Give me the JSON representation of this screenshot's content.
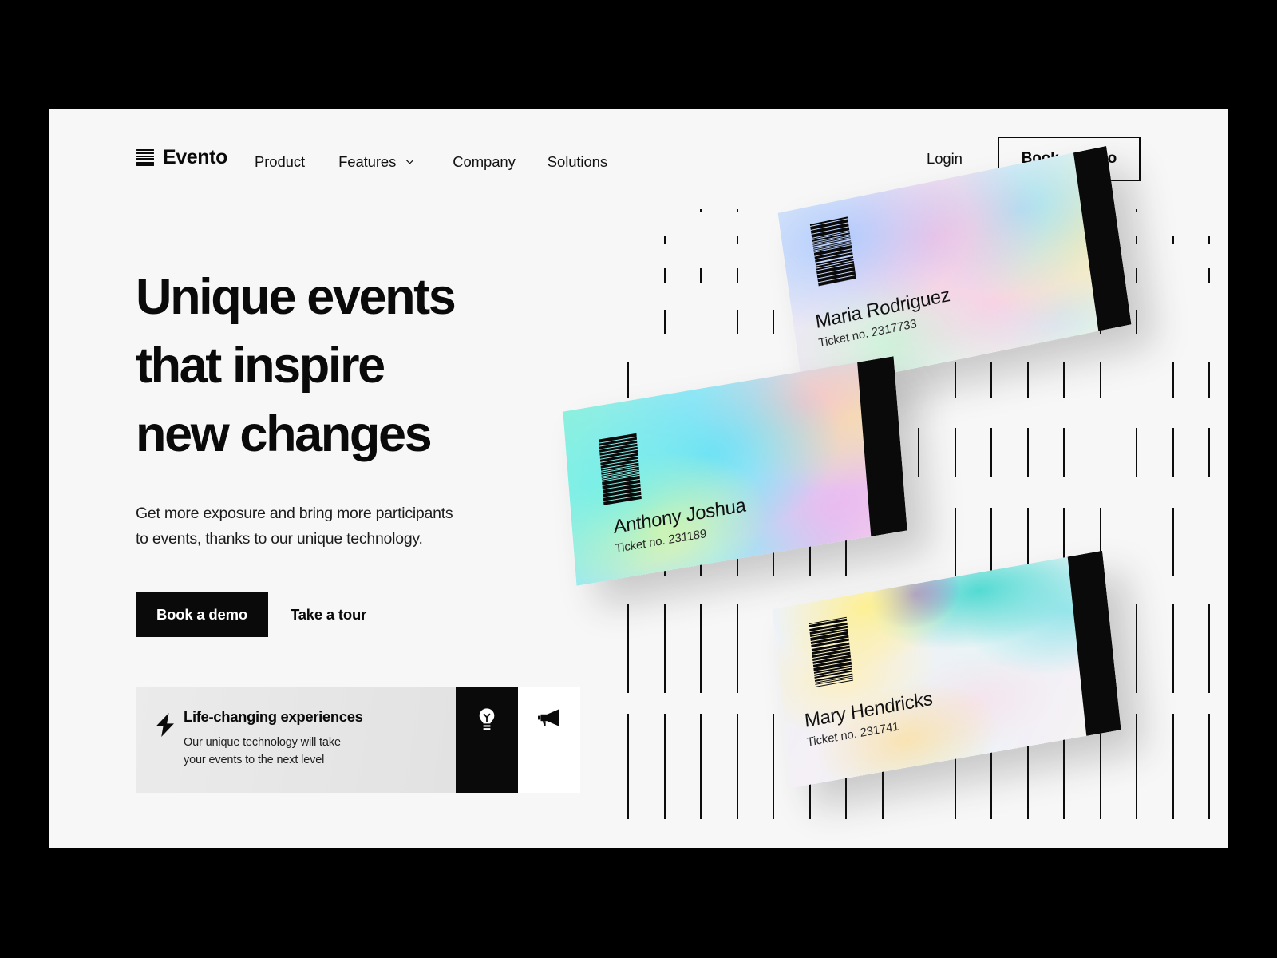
{
  "brand": {
    "name": "Evento",
    "logo_icon": "stacked-bars-icon"
  },
  "nav": {
    "items": [
      {
        "label": "Product",
        "has_dropdown": false
      },
      {
        "label": "Features",
        "has_dropdown": true,
        "icon": "chevron-down-icon"
      },
      {
        "label": "Company",
        "has_dropdown": false
      },
      {
        "label": "Solutions",
        "has_dropdown": false
      }
    ],
    "login_label": "Login",
    "book_demo_label": "Book a Demo"
  },
  "hero": {
    "headline": "Unique events\nthat inspire\nnew changes",
    "subcopy": "Get more exposure and bring more participants\nto events, thanks to our unique technology.",
    "primary_cta": "Book a demo",
    "secondary_cta": "Take a tour"
  },
  "feature_card": {
    "icon": "lightning-bolt-icon",
    "title": "Life-changing experiences",
    "description": "Our unique technology will take\nyour events to the next level",
    "tiles": [
      {
        "icon": "lightbulb-icon",
        "background": "#0a0a0a",
        "foreground": "#ffffff"
      },
      {
        "icon": "megaphone-icon",
        "background": "#ffffff",
        "foreground": "#0a0a0a"
      }
    ]
  },
  "tickets": [
    {
      "name": "Maria Rodriguez",
      "ticket_no": "Ticket no. 2317733"
    },
    {
      "name": "Anthony  Joshua",
      "ticket_no": "Ticket no. 231189"
    },
    {
      "name": "Mary Hendricks",
      "ticket_no": "Ticket no. 231741"
    }
  ],
  "colors": {
    "page_background": "#f7f7f7",
    "outer_background": "#000000",
    "ink": "#0a0a0a",
    "feature_card_background": "#e7e7e7",
    "dash_color": "#0d0d0d"
  }
}
